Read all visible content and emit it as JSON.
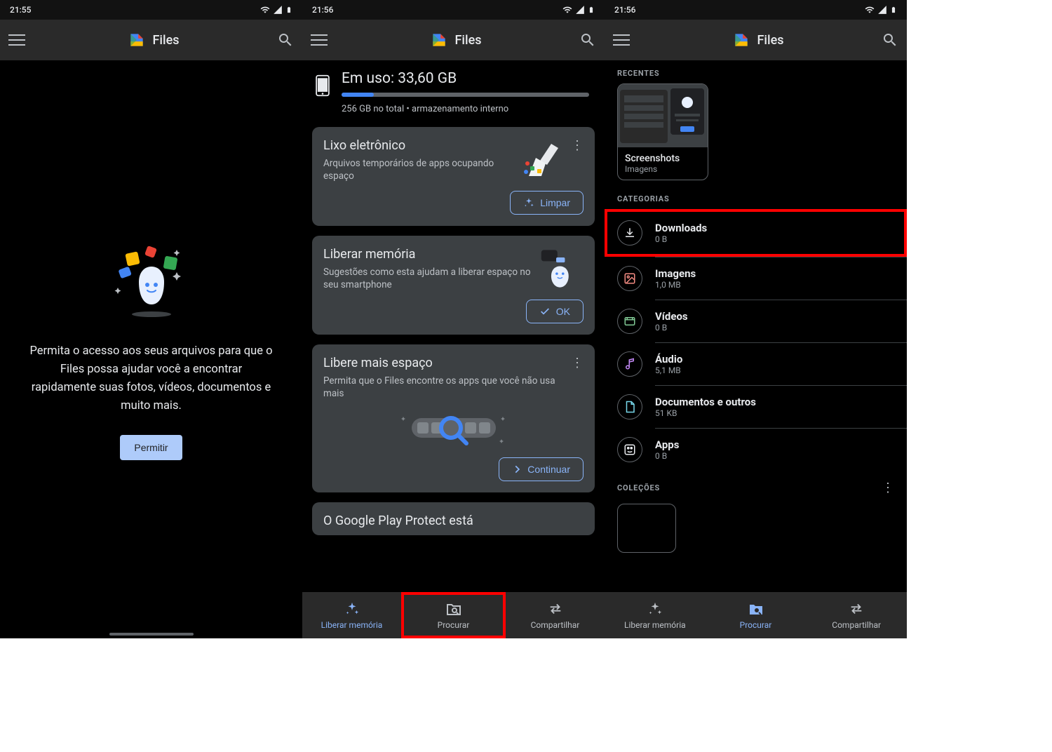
{
  "panel1": {
    "status_time": "21:55",
    "app_title": "Files",
    "message": "Permita o acesso aos seus arquivos para que o Files possa ajudar você a encontrar rapidamente suas fotos, vídeos, documentos e muito mais.",
    "allow_btn": "Permitir"
  },
  "panel2": {
    "status_time": "21:56",
    "app_title": "Files",
    "usage_line": "Em uso: 33,60 GB",
    "total_line": "256 GB no total • armazenamento interno",
    "card_junk": {
      "title": "Lixo eletrônico",
      "desc": "Arquivos temporários de apps ocupando espaço",
      "btn": "Limpar"
    },
    "card_free": {
      "title": "Liberar memória",
      "desc": "Sugestões como esta ajudam a liberar espaço no seu smartphone",
      "btn": "OK"
    },
    "card_more": {
      "title": "Libere mais espaço",
      "desc": "Permita que o Files encontre os apps que você não usa mais",
      "btn": "Continuar"
    },
    "card_play": {
      "title": "O Google Play Protect está"
    },
    "nav": {
      "clean": "Liberar memória",
      "browse": "Procurar",
      "share": "Compartilhar"
    }
  },
  "panel3": {
    "status_time": "21:56",
    "app_title": "Files",
    "recents_header": "RECENTES",
    "recent": {
      "title": "Screenshots",
      "sub": "Imagens"
    },
    "categories_header": "CATEGORIAS",
    "categories": [
      {
        "title": "Downloads",
        "sub": "0 B"
      },
      {
        "title": "Imagens",
        "sub": "1,0 MB"
      },
      {
        "title": "Vídeos",
        "sub": "0 B"
      },
      {
        "title": "Áudio",
        "sub": "5,1 MB"
      },
      {
        "title": "Documentos e outros",
        "sub": "51 KB"
      },
      {
        "title": "Apps",
        "sub": "0 B"
      }
    ],
    "collections_header": "COLEÇÕES",
    "nav": {
      "clean": "Liberar memória",
      "browse": "Procurar",
      "share": "Compartilhar"
    }
  }
}
